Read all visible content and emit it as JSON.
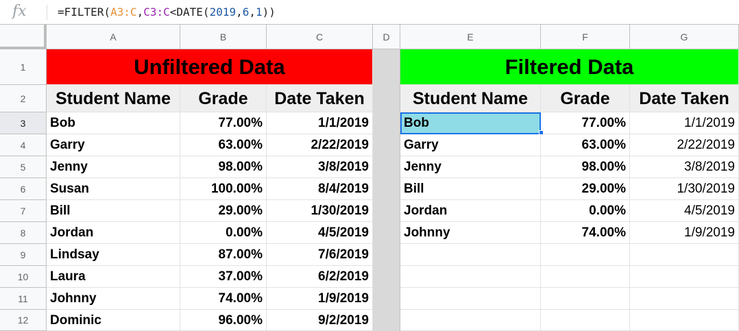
{
  "formula_bar": {
    "fx_label": "fx",
    "formula_parts": [
      {
        "text": "=FILTER(",
        "kind": "plain"
      },
      {
        "text": "A3:C",
        "kind": "rangeA"
      },
      {
        "text": ",",
        "kind": "plain"
      },
      {
        "text": "C3:C",
        "kind": "rangeC"
      },
      {
        "text": "<DATE(",
        "kind": "plain"
      },
      {
        "text": "2019",
        "kind": "num"
      },
      {
        "text": ",",
        "kind": "plain"
      },
      {
        "text": "6",
        "kind": "num"
      },
      {
        "text": ",",
        "kind": "plain"
      },
      {
        "text": "1",
        "kind": "num"
      },
      {
        "text": "))",
        "kind": "plain"
      }
    ]
  },
  "columns": [
    "A",
    "B",
    "C",
    "D",
    "E",
    "F",
    "G"
  ],
  "rows": [
    "1",
    "2",
    "3",
    "4",
    "5",
    "6",
    "7",
    "8",
    "9",
    "10",
    "11",
    "12"
  ],
  "colors": {
    "unfiltered_title_bg": "#ff0000",
    "filtered_title_bg": "#00ff00",
    "header_bg": "#efefef",
    "selected_cell_bg": "#8fdce6",
    "selection_border": "#1a73e8"
  },
  "unfiltered": {
    "title": "Unfiltered Data",
    "headers": [
      "Student Name",
      "Grade",
      "Date Taken"
    ],
    "rows": [
      [
        "Bob",
        "77.00%",
        "1/1/2019"
      ],
      [
        "Garry",
        "63.00%",
        "2/22/2019"
      ],
      [
        "Jenny",
        "98.00%",
        "3/8/2019"
      ],
      [
        "Susan",
        "100.00%",
        "8/4/2019"
      ],
      [
        "Bill",
        "29.00%",
        "1/30/2019"
      ],
      [
        "Jordan",
        "0.00%",
        "4/5/2019"
      ],
      [
        "Lindsay",
        "87.00%",
        "7/6/2019"
      ],
      [
        "Laura",
        "37.00%",
        "6/2/2019"
      ],
      [
        "Johnny",
        "74.00%",
        "1/9/2019"
      ],
      [
        "Dominic",
        "96.00%",
        "9/2/2019"
      ]
    ]
  },
  "filtered": {
    "title": "Filtered Data",
    "headers": [
      "Student Name",
      "Grade",
      "Date Taken"
    ],
    "rows": [
      [
        "Bob",
        "77.00%",
        "1/1/2019"
      ],
      [
        "Garry",
        "63.00%",
        "2/22/2019"
      ],
      [
        "Jenny",
        "98.00%",
        "3/8/2019"
      ],
      [
        "Bill",
        "29.00%",
        "1/30/2019"
      ],
      [
        "Jordan",
        "0.00%",
        "4/5/2019"
      ],
      [
        "Johnny",
        "74.00%",
        "1/9/2019"
      ]
    ],
    "selected_cell": "E3"
  }
}
